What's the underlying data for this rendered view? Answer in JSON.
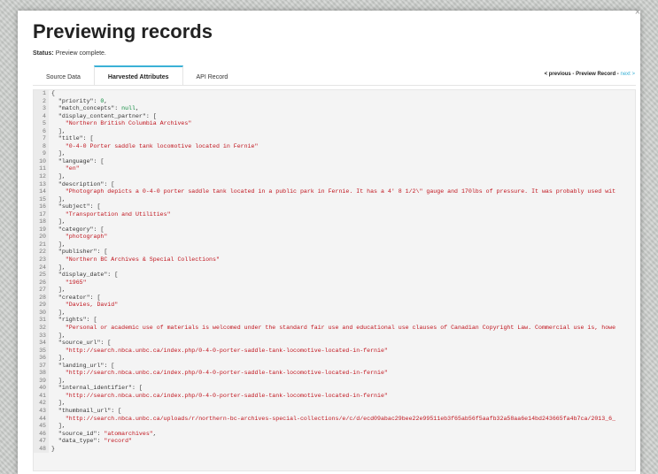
{
  "modal": {
    "title": "Previewing records",
    "close_label": "×",
    "status_label": "Status:",
    "status_text": "Preview complete."
  },
  "tabs": [
    {
      "label": "Source Data",
      "active": false
    },
    {
      "label": "Harvested Attributes",
      "active": true
    },
    {
      "label": "API Record",
      "active": false
    }
  ],
  "pager": {
    "previous": "< previous",
    "separator": " - ",
    "current": "Preview Record",
    "separator2": " - ",
    "next": "next >"
  },
  "code_lines": [
    [
      [
        "p",
        "{"
      ]
    ],
    [
      [
        "k",
        "  \"priority\": "
      ],
      [
        "n",
        "0"
      ],
      [
        "p",
        ","
      ]
    ],
    [
      [
        "k",
        "  \"match_concepts\": "
      ],
      [
        "n",
        "null"
      ],
      [
        "p",
        ","
      ]
    ],
    [
      [
        "k",
        "  \"display_content_partner\": ["
      ]
    ],
    [
      [
        "s",
        "    \"Northern British Columbia Archives\""
      ]
    ],
    [
      [
        "p",
        "  ],"
      ]
    ],
    [
      [
        "k",
        "  \"title\": ["
      ]
    ],
    [
      [
        "s",
        "    \"0-4-0 Porter saddle tank locomotive located in Fernie\""
      ]
    ],
    [
      [
        "p",
        "  ],"
      ]
    ],
    [
      [
        "k",
        "  \"language\": ["
      ]
    ],
    [
      [
        "s",
        "    \"en\""
      ]
    ],
    [
      [
        "p",
        "  ],"
      ]
    ],
    [
      [
        "k",
        "  \"description\": ["
      ]
    ],
    [
      [
        "s",
        "    \"Photograph depicts a 0-4-0 porter saddle tank located in a public park in Fernie. It has a 4' 8 1/2\\\" gauge and 170lbs of pressure. It was probably used wit"
      ]
    ],
    [
      [
        "p",
        "  ],"
      ]
    ],
    [
      [
        "k",
        "  \"subject\": ["
      ]
    ],
    [
      [
        "s",
        "    \"Transportation and Utilities\""
      ]
    ],
    [
      [
        "p",
        "  ],"
      ]
    ],
    [
      [
        "k",
        "  \"category\": ["
      ]
    ],
    [
      [
        "s",
        "    \"photograph\""
      ]
    ],
    [
      [
        "p",
        "  ],"
      ]
    ],
    [
      [
        "k",
        "  \"publisher\": ["
      ]
    ],
    [
      [
        "s",
        "    \"Northern BC Archives & Special Collections\""
      ]
    ],
    [
      [
        "p",
        "  ],"
      ]
    ],
    [
      [
        "k",
        "  \"display_date\": ["
      ]
    ],
    [
      [
        "s",
        "    \"1965\""
      ]
    ],
    [
      [
        "p",
        "  ],"
      ]
    ],
    [
      [
        "k",
        "  \"creator\": ["
      ]
    ],
    [
      [
        "s",
        "    \"Davies, David\""
      ]
    ],
    [
      [
        "p",
        "  ],"
      ]
    ],
    [
      [
        "k",
        "  \"rights\": ["
      ]
    ],
    [
      [
        "s",
        "    \"Personal or academic use of materials is welcomed under the standard fair use and educational use clauses of Canadian Copyright Law. Commercial use is, howe"
      ]
    ],
    [
      [
        "p",
        "  ],"
      ]
    ],
    [
      [
        "k",
        "  \"source_url\": ["
      ]
    ],
    [
      [
        "s",
        "    \"http://search.nbca.unbc.ca/index.php/0-4-0-porter-saddle-tank-locomotive-located-in-fernie\""
      ]
    ],
    [
      [
        "p",
        "  ],"
      ]
    ],
    [
      [
        "k",
        "  \"landing_url\": ["
      ]
    ],
    [
      [
        "s",
        "    \"http://search.nbca.unbc.ca/index.php/0-4-0-porter-saddle-tank-locomotive-located-in-fernie\""
      ]
    ],
    [
      [
        "p",
        "  ],"
      ]
    ],
    [
      [
        "k",
        "  \"internal_identifier\": ["
      ]
    ],
    [
      [
        "s",
        "    \"http://search.nbca.unbc.ca/index.php/0-4-0-porter-saddle-tank-locomotive-located-in-fernie\""
      ]
    ],
    [
      [
        "p",
        "  ],"
      ]
    ],
    [
      [
        "k",
        "  \"thumbnail_url\": ["
      ]
    ],
    [
      [
        "s",
        "    \"http://search.nbca.unbc.ca/uploads/r/northern-bc-archives-special-collections/e/c/d/ecd09abac29bee22e99511eb3f65ab56f5aafb32a58aa6e14bd243665fa4b7ca/2013_6_"
      ]
    ],
    [
      [
        "p",
        "  ],"
      ]
    ],
    [
      [
        "k",
        "  \"source_id\": "
      ],
      [
        "s",
        "\"atomarchives\""
      ],
      [
        "p",
        ","
      ]
    ],
    [
      [
        "k",
        "  \"data_type\": "
      ],
      [
        "s",
        "\"record\""
      ]
    ],
    [
      [
        "p",
        "}"
      ]
    ]
  ]
}
